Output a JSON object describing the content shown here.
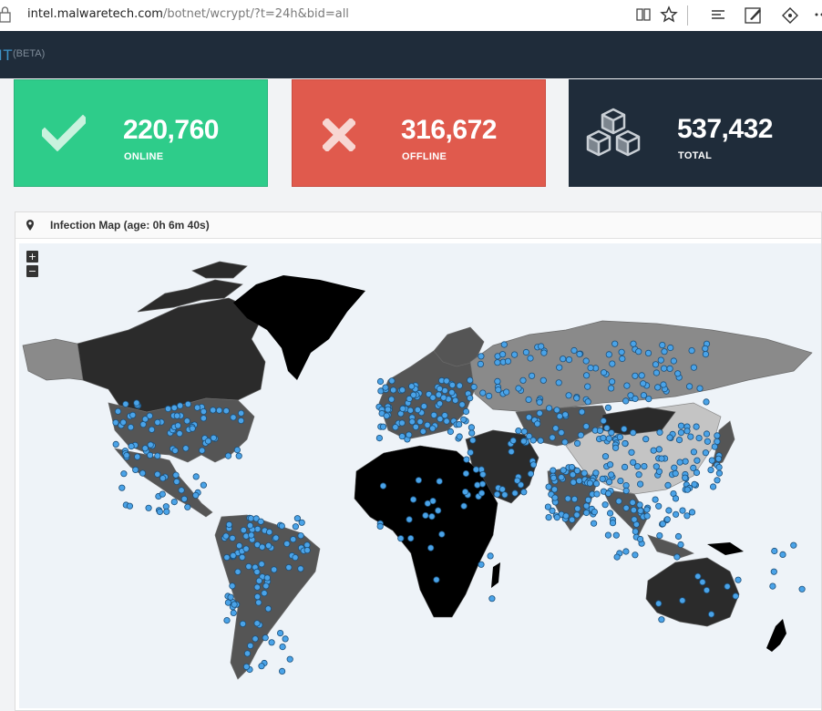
{
  "browser": {
    "url_host": "intel.malwaretech.com",
    "url_path": "/botnet/wcrypt/?t=24h&bid=all",
    "icons": [
      "lock-icon",
      "reading-view-icon",
      "favorite-star-icon",
      "hub-icon",
      "web-note-icon",
      "share-icon",
      "more-icon"
    ]
  },
  "header": {
    "brand": "IT",
    "beta": "(BETA)"
  },
  "stats": {
    "online": {
      "value": "220,760",
      "label": "ONLINE",
      "icon": "check-icon",
      "color": "#2ecc8a"
    },
    "offline": {
      "value": "316,672",
      "label": "OFFLINE",
      "icon": "x-icon",
      "color": "#e05a4d"
    },
    "total": {
      "value": "537,432",
      "label": "TOTAL",
      "icon": "cubes-icon",
      "color": "#1f2c3a"
    }
  },
  "map_panel": {
    "title": "Infection Map (age: 0h 6m 40s)",
    "zoom_in": "+",
    "zoom_out": "−",
    "marker_color": "#4aa3e8",
    "land_colors": [
      "#000000",
      "#2b2b2b",
      "#555555",
      "#8a8a8a",
      "#c4c4c4"
    ],
    "ocean_color": "#eef3f8"
  }
}
